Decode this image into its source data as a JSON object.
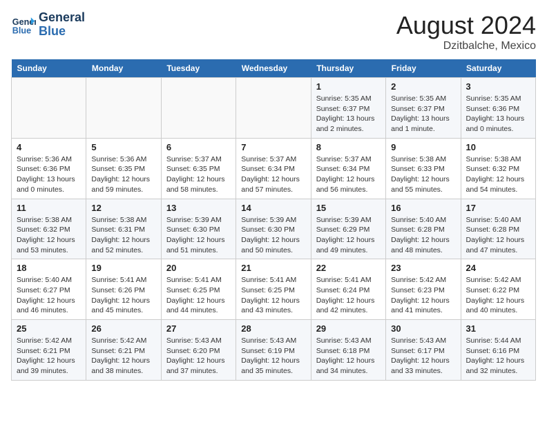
{
  "header": {
    "logo_line1": "General",
    "logo_line2": "Blue",
    "month_year": "August 2024",
    "location": "Dzitbalche, Mexico"
  },
  "days_of_week": [
    "Sunday",
    "Monday",
    "Tuesday",
    "Wednesday",
    "Thursday",
    "Friday",
    "Saturday"
  ],
  "weeks": [
    [
      {
        "day": "",
        "info": ""
      },
      {
        "day": "",
        "info": ""
      },
      {
        "day": "",
        "info": ""
      },
      {
        "day": "",
        "info": ""
      },
      {
        "day": "1",
        "info": "Sunrise: 5:35 AM\nSunset: 6:37 PM\nDaylight: 13 hours\nand 2 minutes."
      },
      {
        "day": "2",
        "info": "Sunrise: 5:35 AM\nSunset: 6:37 PM\nDaylight: 13 hours\nand 1 minute."
      },
      {
        "day": "3",
        "info": "Sunrise: 5:35 AM\nSunset: 6:36 PM\nDaylight: 13 hours\nand 0 minutes."
      }
    ],
    [
      {
        "day": "4",
        "info": "Sunrise: 5:36 AM\nSunset: 6:36 PM\nDaylight: 13 hours\nand 0 minutes."
      },
      {
        "day": "5",
        "info": "Sunrise: 5:36 AM\nSunset: 6:35 PM\nDaylight: 12 hours\nand 59 minutes."
      },
      {
        "day": "6",
        "info": "Sunrise: 5:37 AM\nSunset: 6:35 PM\nDaylight: 12 hours\nand 58 minutes."
      },
      {
        "day": "7",
        "info": "Sunrise: 5:37 AM\nSunset: 6:34 PM\nDaylight: 12 hours\nand 57 minutes."
      },
      {
        "day": "8",
        "info": "Sunrise: 5:37 AM\nSunset: 6:34 PM\nDaylight: 12 hours\nand 56 minutes."
      },
      {
        "day": "9",
        "info": "Sunrise: 5:38 AM\nSunset: 6:33 PM\nDaylight: 12 hours\nand 55 minutes."
      },
      {
        "day": "10",
        "info": "Sunrise: 5:38 AM\nSunset: 6:32 PM\nDaylight: 12 hours\nand 54 minutes."
      }
    ],
    [
      {
        "day": "11",
        "info": "Sunrise: 5:38 AM\nSunset: 6:32 PM\nDaylight: 12 hours\nand 53 minutes."
      },
      {
        "day": "12",
        "info": "Sunrise: 5:38 AM\nSunset: 6:31 PM\nDaylight: 12 hours\nand 52 minutes."
      },
      {
        "day": "13",
        "info": "Sunrise: 5:39 AM\nSunset: 6:30 PM\nDaylight: 12 hours\nand 51 minutes."
      },
      {
        "day": "14",
        "info": "Sunrise: 5:39 AM\nSunset: 6:30 PM\nDaylight: 12 hours\nand 50 minutes."
      },
      {
        "day": "15",
        "info": "Sunrise: 5:39 AM\nSunset: 6:29 PM\nDaylight: 12 hours\nand 49 minutes."
      },
      {
        "day": "16",
        "info": "Sunrise: 5:40 AM\nSunset: 6:28 PM\nDaylight: 12 hours\nand 48 minutes."
      },
      {
        "day": "17",
        "info": "Sunrise: 5:40 AM\nSunset: 6:28 PM\nDaylight: 12 hours\nand 47 minutes."
      }
    ],
    [
      {
        "day": "18",
        "info": "Sunrise: 5:40 AM\nSunset: 6:27 PM\nDaylight: 12 hours\nand 46 minutes."
      },
      {
        "day": "19",
        "info": "Sunrise: 5:41 AM\nSunset: 6:26 PM\nDaylight: 12 hours\nand 45 minutes."
      },
      {
        "day": "20",
        "info": "Sunrise: 5:41 AM\nSunset: 6:25 PM\nDaylight: 12 hours\nand 44 minutes."
      },
      {
        "day": "21",
        "info": "Sunrise: 5:41 AM\nSunset: 6:25 PM\nDaylight: 12 hours\nand 43 minutes."
      },
      {
        "day": "22",
        "info": "Sunrise: 5:41 AM\nSunset: 6:24 PM\nDaylight: 12 hours\nand 42 minutes."
      },
      {
        "day": "23",
        "info": "Sunrise: 5:42 AM\nSunset: 6:23 PM\nDaylight: 12 hours\nand 41 minutes."
      },
      {
        "day": "24",
        "info": "Sunrise: 5:42 AM\nSunset: 6:22 PM\nDaylight: 12 hours\nand 40 minutes."
      }
    ],
    [
      {
        "day": "25",
        "info": "Sunrise: 5:42 AM\nSunset: 6:21 PM\nDaylight: 12 hours\nand 39 minutes."
      },
      {
        "day": "26",
        "info": "Sunrise: 5:42 AM\nSunset: 6:21 PM\nDaylight: 12 hours\nand 38 minutes."
      },
      {
        "day": "27",
        "info": "Sunrise: 5:43 AM\nSunset: 6:20 PM\nDaylight: 12 hours\nand 37 minutes."
      },
      {
        "day": "28",
        "info": "Sunrise: 5:43 AM\nSunset: 6:19 PM\nDaylight: 12 hours\nand 35 minutes."
      },
      {
        "day": "29",
        "info": "Sunrise: 5:43 AM\nSunset: 6:18 PM\nDaylight: 12 hours\nand 34 minutes."
      },
      {
        "day": "30",
        "info": "Sunrise: 5:43 AM\nSunset: 6:17 PM\nDaylight: 12 hours\nand 33 minutes."
      },
      {
        "day": "31",
        "info": "Sunrise: 5:44 AM\nSunset: 6:16 PM\nDaylight: 12 hours\nand 32 minutes."
      }
    ]
  ]
}
